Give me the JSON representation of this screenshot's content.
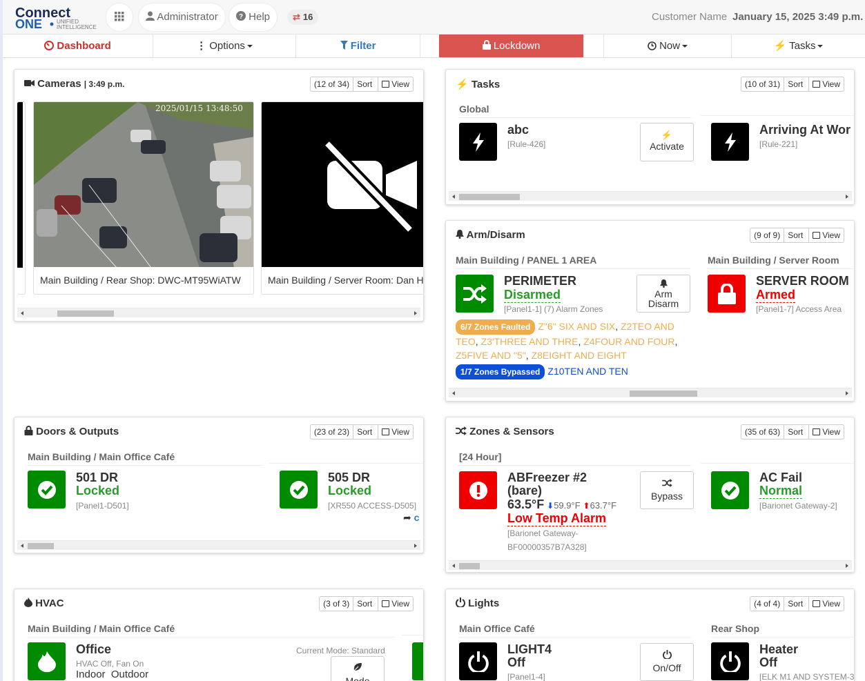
{
  "brand": {
    "logo_top": "Connect",
    "logo_one": "ONE",
    "logo_sub1": "UNIFIED",
    "logo_sub2": "INTELLIGENCE"
  },
  "header": {
    "admin_label": "Administrator",
    "help_label": "Help",
    "badge_count": "16",
    "customer_name": "Customer Name",
    "datetime": "January 15, 2025 3:49 p.m."
  },
  "nav": {
    "dashboard": "Dashboard",
    "options": "Options",
    "filter": "Filter",
    "lockdown": "Lockdown",
    "now": "Now",
    "tasks": "Tasks"
  },
  "cameras": {
    "title": "Cameras",
    "time": "| 3:49 p.m.",
    "count": "(12 of 34)",
    "sort": "Sort",
    "view": "View",
    "items": [
      {
        "caption": "Main Building / Rear Shop: DWC-MT95WiATW",
        "timestamp": "2025/01/15 13:48:50"
      },
      {
        "caption": "Main Building / Server Room: Dan H"
      }
    ]
  },
  "tasks": {
    "title": "Tasks",
    "count": "(10 of 31)",
    "sort": "Sort",
    "view": "View",
    "section": "Global",
    "items": [
      {
        "name": "abc",
        "sub": "[Rule-426]",
        "button": "Activate"
      },
      {
        "name": "Arriving At Wor",
        "sub": "[Rule-221]"
      }
    ]
  },
  "arm": {
    "title": "Arm/Disarm",
    "count": "(9 of 9)",
    "sort": "Sort",
    "view": "View",
    "sections": [
      "Main Building / PANEL 1 AREA",
      "Main Building / Server Room"
    ],
    "items": [
      {
        "name": "PERIMETER",
        "status": "Disarmed",
        "sub": "[Panel1-1] (7) Alarm Zones",
        "button_l1": "Arm",
        "button_l2": "Disarm"
      },
      {
        "name": "SERVER ROOM",
        "status": "Armed",
        "sub": "[Panel1-7] Access Area"
      }
    ],
    "faulted_pill": "6/7 Zones Faulted",
    "faulted_zones": [
      "Z\"6\" SIX AND SIX",
      "Z2TEO AND TEO",
      "Z3'THREE AND THRE",
      "Z4FOUR AND FOUR",
      "Z5FIVE AND \"5\"",
      "Z8EIGHT AND EIGHT"
    ],
    "bypassed_pill": "1/7 Zones Bypassed",
    "bypassed_zone": "Z10TEN AND TEN"
  },
  "doors": {
    "title": "Doors & Outputs",
    "count": "(23 of 23)",
    "sort": "Sort",
    "view": "View",
    "section": "Main Building / Main Office Café",
    "items": [
      {
        "name": "501 DR",
        "status": "Locked",
        "sub": "[Panel1-D501]"
      },
      {
        "name": "505 DR",
        "status": "Locked",
        "sub": "[XR550 ACCESS-D505]"
      }
    ]
  },
  "zones": {
    "title": "Zones & Sensors",
    "count": "(35 of 63)",
    "sort": "Sort",
    "view": "View",
    "section": "[24 Hour]",
    "items": [
      {
        "name_l1": "ABFreezer #2",
        "name_l2": "(bare)",
        "temp": "63.5°F",
        "low": "59.9°F",
        "high": "63.7°F",
        "status": "Low Temp Alarm",
        "sub_l1": "[Barionet Gateway-",
        "sub_l2": "BF00000357B7A328]",
        "button": "Bypass"
      },
      {
        "name": "AC Fail",
        "status": "Normal",
        "sub": "[Barionet Gateway-2]"
      }
    ]
  },
  "hvac": {
    "title": "HVAC",
    "count": "(3 of 3)",
    "sort": "Sort",
    "view": "View",
    "section": "Main Building / Main Office Café",
    "item": {
      "name": "Office",
      "mode": "Current Mode: Standard",
      "state": "HVAC Off, Fan On",
      "indoor": "Indoor",
      "outdoor": "Outdoor",
      "button": "Mode"
    }
  },
  "lights": {
    "title": "Lights",
    "count": "(4 of 4)",
    "sort": "Sort",
    "view": "View",
    "sections": [
      "Main Office Café",
      "Rear Shop"
    ],
    "items": [
      {
        "name": "LIGHT4",
        "status": "Off",
        "sub": "[Panel1-4]",
        "button": "On/Off"
      },
      {
        "name": "Heater",
        "status": "Off",
        "sub": "[ELK M1 AND SYSTEM-3"
      }
    ]
  },
  "colors": {
    "accent": "#337ab7",
    "lockdown": "#d9534f",
    "green_tile": "#008a00",
    "red_tile": "#ee0000",
    "faulted": "#f0ad4e",
    "bypassed": "#0d4fd6"
  }
}
